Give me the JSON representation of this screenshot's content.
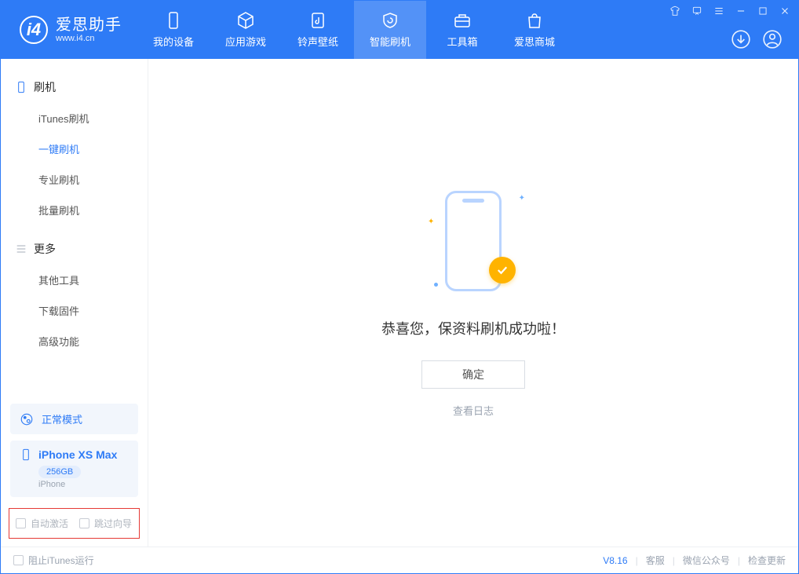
{
  "app": {
    "name": "爱思助手",
    "domain": "www.i4.cn"
  },
  "nav": {
    "tabs": [
      {
        "label": "我的设备"
      },
      {
        "label": "应用游戏"
      },
      {
        "label": "铃声壁纸"
      },
      {
        "label": "智能刷机"
      },
      {
        "label": "工具箱"
      },
      {
        "label": "爱思商城"
      }
    ]
  },
  "sidebar": {
    "groups": [
      {
        "title": "刷机",
        "items": [
          "iTunes刷机",
          "一键刷机",
          "专业刷机",
          "批量刷机"
        ],
        "activeIndex": 1
      },
      {
        "title": "更多",
        "items": [
          "其他工具",
          "下载固件",
          "高级功能"
        ]
      }
    ],
    "mode": "正常模式",
    "device": {
      "name": "iPhone XS Max",
      "capacity": "256GB",
      "type": "iPhone"
    },
    "options": {
      "autoActivate": "自动激活",
      "skipGuide": "跳过向导"
    }
  },
  "main": {
    "successTitle": "恭喜您，保资料刷机成功啦！",
    "okButton": "确定",
    "viewLog": "查看日志"
  },
  "footer": {
    "blockItunes": "阻止iTunes运行",
    "version": "V8.16",
    "links": [
      "客服",
      "微信公众号",
      "检查更新"
    ]
  }
}
